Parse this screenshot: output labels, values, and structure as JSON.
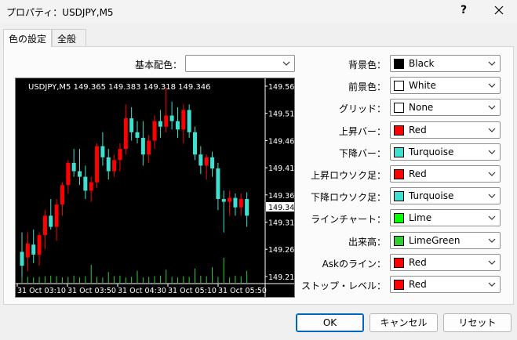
{
  "window": {
    "title": "プロパティ：USDJPY,M5",
    "help": "?"
  },
  "tabs": [
    {
      "label": "色の設定"
    },
    {
      "label": "全般"
    }
  ],
  "scheme": {
    "label": "基本配色：",
    "value": ""
  },
  "properties": [
    {
      "label": "背景色：",
      "value": "Black",
      "color": "#000000"
    },
    {
      "label": "前景色：",
      "value": "White",
      "color": "#ffffff"
    },
    {
      "label": "グリッド：",
      "value": "None",
      "color": "#ffffff"
    },
    {
      "label": "上昇バー：",
      "value": "Red",
      "color": "#ff0000"
    },
    {
      "label": "下降バー：",
      "value": "Turquoise",
      "color": "#40e0d0"
    },
    {
      "label": "上昇ロウソク足：",
      "value": "Red",
      "color": "#ff0000"
    },
    {
      "label": "下降ロウソク足：",
      "value": "Turquoise",
      "color": "#40e0d0"
    },
    {
      "label": "ラインチャート：",
      "value": "Lime",
      "color": "#00ff00"
    },
    {
      "label": "出来高：",
      "value": "LimeGreen",
      "color": "#32cd32"
    },
    {
      "label": "Askのライン：",
      "value": "Red",
      "color": "#ff0000"
    },
    {
      "label": "ストップ・レベル：",
      "value": "Red",
      "color": "#ff0000"
    }
  ],
  "buttons": {
    "ok": "OK",
    "cancel": "キャンセル",
    "reset": "リセット"
  },
  "chart_data": {
    "type": "candlestick",
    "header": "USDJPY,M5  149.365 149.383 149.318 149.346",
    "y_ticks": [
      "149.560",
      "149.510",
      "149.460",
      "149.410",
      "149.360",
      "149.315",
      "149.265",
      "149.215"
    ],
    "current_price": "149.346",
    "x_ticks": [
      "31 Oct 03:10",
      "31 Oct 03:50",
      "31 Oct 04:30",
      "31 Oct 05:10",
      "31 Oct 05:50"
    ],
    "ylim": [
      149.215,
      149.56
    ],
    "up_color": "#ff0000",
    "down_color": "#40e0d0",
    "volume_color": "#32cd32",
    "candles": [
      {
        "o": 149.265,
        "h": 149.3,
        "l": 149.22,
        "c": 149.24
      },
      {
        "o": 149.255,
        "h": 149.3,
        "l": 149.23,
        "c": 149.28
      },
      {
        "o": 149.278,
        "h": 149.305,
        "l": 149.245,
        "c": 149.26
      },
      {
        "o": 149.26,
        "h": 149.3,
        "l": 149.24,
        "c": 149.295
      },
      {
        "o": 149.295,
        "h": 149.34,
        "l": 149.27,
        "c": 149.33
      },
      {
        "o": 149.33,
        "h": 149.36,
        "l": 149.305,
        "c": 149.31
      },
      {
        "o": 149.31,
        "h": 149.36,
        "l": 149.285,
        "c": 149.35
      },
      {
        "o": 149.35,
        "h": 149.39,
        "l": 149.33,
        "c": 149.385
      },
      {
        "o": 149.385,
        "h": 149.43,
        "l": 149.37,
        "c": 149.425
      },
      {
        "o": 149.425,
        "h": 149.45,
        "l": 149.4,
        "c": 149.41
      },
      {
        "o": 149.41,
        "h": 149.45,
        "l": 149.385,
        "c": 149.4
      },
      {
        "o": 149.4,
        "h": 149.42,
        "l": 149.36,
        "c": 149.375
      },
      {
        "o": 149.375,
        "h": 149.4,
        "l": 149.355,
        "c": 149.39
      },
      {
        "o": 149.39,
        "h": 149.46,
        "l": 149.38,
        "c": 149.455
      },
      {
        "o": 149.455,
        "h": 149.48,
        "l": 149.42,
        "c": 149.435
      },
      {
        "o": 149.435,
        "h": 149.45,
        "l": 149.395,
        "c": 149.41
      },
      {
        "o": 149.41,
        "h": 149.44,
        "l": 149.4,
        "c": 149.43
      },
      {
        "o": 149.43,
        "h": 149.46,
        "l": 149.41,
        "c": 149.45
      },
      {
        "o": 149.45,
        "h": 149.53,
        "l": 149.44,
        "c": 149.505
      },
      {
        "o": 149.505,
        "h": 149.525,
        "l": 149.465,
        "c": 149.48
      },
      {
        "o": 149.48,
        "h": 149.5,
        "l": 149.46,
        "c": 149.47
      },
      {
        "o": 149.47,
        "h": 149.5,
        "l": 149.42,
        "c": 149.44
      },
      {
        "o": 149.44,
        "h": 149.475,
        "l": 149.425,
        "c": 149.465
      },
      {
        "o": 149.465,
        "h": 149.51,
        "l": 149.45,
        "c": 149.5
      },
      {
        "o": 149.5,
        "h": 149.52,
        "l": 149.47,
        "c": 149.49
      },
      {
        "o": 149.49,
        "h": 149.56,
        "l": 149.48,
        "c": 149.51
      },
      {
        "o": 149.51,
        "h": 149.535,
        "l": 149.485,
        "c": 149.5
      },
      {
        "o": 149.5,
        "h": 149.525,
        "l": 149.47,
        "c": 149.485
      },
      {
        "o": 149.485,
        "h": 149.53,
        "l": 149.46,
        "c": 149.52
      },
      {
        "o": 149.52,
        "h": 149.53,
        "l": 149.47,
        "c": 149.48
      },
      {
        "o": 149.48,
        "h": 149.49,
        "l": 149.43,
        "c": 149.44
      },
      {
        "o": 149.44,
        "h": 149.455,
        "l": 149.405,
        "c": 149.42
      },
      {
        "o": 149.42,
        "h": 149.44,
        "l": 149.395,
        "c": 149.435
      },
      {
        "o": 149.435,
        "h": 149.445,
        "l": 149.4,
        "c": 149.415
      },
      {
        "o": 149.415,
        "h": 149.425,
        "l": 149.34,
        "c": 149.36
      },
      {
        "o": 149.36,
        "h": 149.375,
        "l": 149.3,
        "c": 149.355
      },
      {
        "o": 149.355,
        "h": 149.375,
        "l": 149.33,
        "c": 149.362
      },
      {
        "o": 149.362,
        "h": 149.37,
        "l": 149.33,
        "c": 149.345
      },
      {
        "o": 149.345,
        "h": 149.37,
        "l": 149.33,
        "c": 149.36
      },
      {
        "o": 149.36,
        "h": 149.372,
        "l": 149.31,
        "c": 149.33
      }
    ],
    "volumes": [
      12,
      10,
      9,
      10,
      11,
      12,
      11,
      9,
      10,
      12,
      9,
      11,
      30,
      10,
      9,
      18,
      11,
      12,
      9,
      10,
      20,
      9,
      10,
      11,
      12,
      22,
      10,
      9,
      11,
      10,
      24,
      12,
      11,
      26,
      10,
      42,
      9,
      12,
      11,
      20
    ]
  }
}
